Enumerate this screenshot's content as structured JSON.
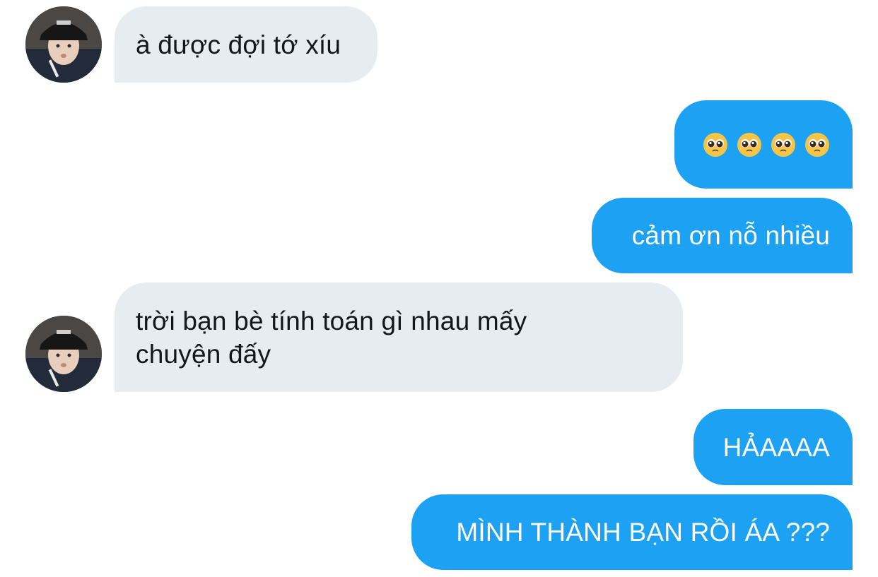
{
  "conversation": {
    "messages": [
      {
        "direction": "incoming",
        "text": "à được đợi tớ xíu"
      },
      {
        "direction": "outgoing",
        "emoji": [
          "pleading-face",
          "pleading-face",
          "pleading-face",
          "pleading-face"
        ]
      },
      {
        "direction": "outgoing",
        "text": "cảm ơn nỗ nhiều"
      },
      {
        "direction": "incoming",
        "text": "trời bạn bè tính toán gì nhau mấy chuyện đấy"
      },
      {
        "direction": "outgoing",
        "text": "HẢAAAA"
      },
      {
        "direction": "outgoing",
        "text": "MÌNH THÀNH BẠN RỒI ÁA ???"
      }
    ]
  },
  "colors": {
    "incoming_bubble": "#e6ecf0",
    "incoming_text": "#14171a",
    "outgoing_bubble": "#1da1f2",
    "outgoing_text": "#ffffff",
    "emoji_face": "#f7c545"
  }
}
